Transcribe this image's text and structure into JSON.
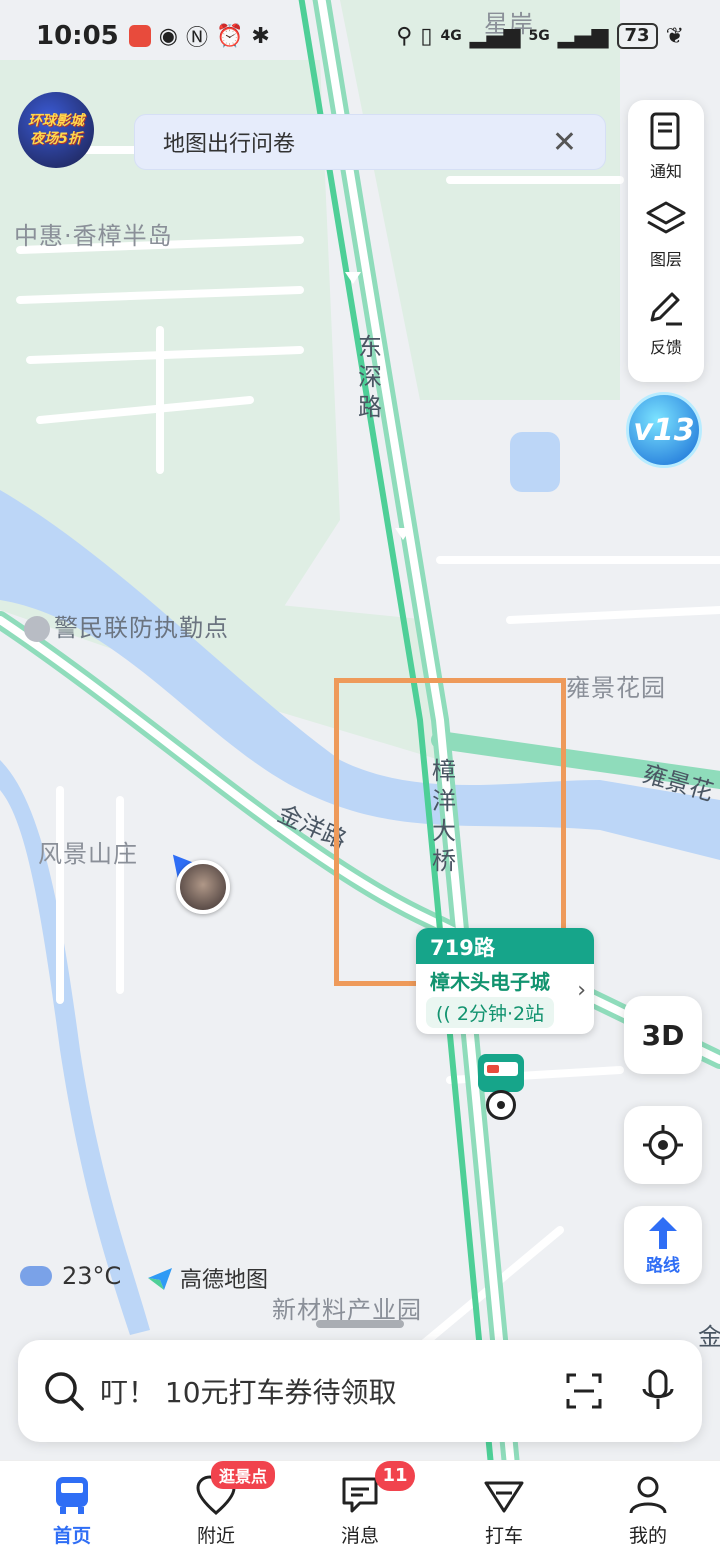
{
  "status_bar": {
    "time": "10:05",
    "network_1": "4G",
    "network_2": "5G",
    "battery": "73"
  },
  "promo": {
    "line1": "环球影城",
    "line2": "夜场5折"
  },
  "survey_banner": {
    "text": "地图出行问卷"
  },
  "tools": {
    "notice_label": "通知",
    "layers_label": "图层",
    "feedback_label": "反馈"
  },
  "vip_badge": "v13",
  "map_labels": {
    "poi_1": "中惠·香樟半岛",
    "poi_2": "警民联防执勤点",
    "poi_3": "雍景花园",
    "poi_4": "风景山庄",
    "poi_5": "新材料产业园",
    "poi_6": "星岸",
    "road_1": "东深路",
    "road_2": "樟洋大桥",
    "road_3": "金洋路",
    "road_4": "雍景花",
    "road_5": "金"
  },
  "bus_card": {
    "route": "719路",
    "stop": "樟木头电子城",
    "eta": "2分钟·2站"
  },
  "buttons": {
    "three_d": "3D",
    "route_label": "路线"
  },
  "weather": {
    "temp": "23°C"
  },
  "brand": {
    "name": "高德地图"
  },
  "search": {
    "text": "叮！ 10元打车券待领取"
  },
  "tabs": [
    {
      "label": "首页",
      "icon": "bus-icon"
    },
    {
      "label": "附近",
      "icon": "location-heart-icon",
      "badge": "逛景点"
    },
    {
      "label": "消息",
      "icon": "message-icon",
      "badge": "11"
    },
    {
      "label": "打车",
      "icon": "taxi-icon"
    },
    {
      "label": "我的",
      "icon": "user-icon"
    }
  ],
  "colors": {
    "accent": "#2f6ef5",
    "bus_green": "#16a58a",
    "road_green": "#8fdcbb",
    "water": "#bcd6f7",
    "green_area": "#dfeee4",
    "badge_red": "#f1434d",
    "highlight_orange": "#ee9a5a"
  }
}
